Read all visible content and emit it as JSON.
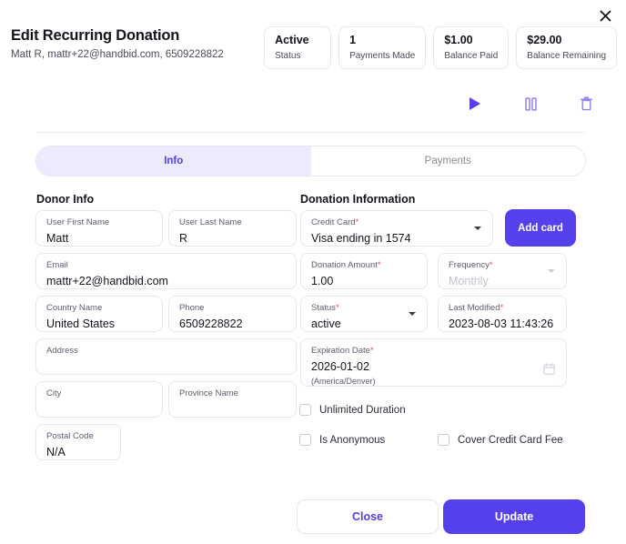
{
  "window": {
    "close_icon": "close-x-icon"
  },
  "header": {
    "title": "Edit Recurring Donation",
    "subtitle": "Matt R, mattr+22@handbid.com, 6509228822",
    "stats": [
      {
        "value": "Active",
        "label": "Status"
      },
      {
        "value": "1",
        "label": "Payments Made"
      },
      {
        "value": "$1.00",
        "label": "Balance Paid"
      },
      {
        "value": "$29.00",
        "label": "Balance Remaining"
      }
    ]
  },
  "actions": [
    {
      "name": "play-icon",
      "tooltip": "Resume"
    },
    {
      "name": "pause-icon",
      "tooltip": "Pause"
    },
    {
      "name": "trash-icon",
      "tooltip": "Delete"
    }
  ],
  "tabs": [
    {
      "label": "Info",
      "active": true
    },
    {
      "label": "Payments",
      "active": false
    }
  ],
  "donor": {
    "section_title": "Donor Info",
    "first_name": {
      "label": "User First Name",
      "value": "Matt"
    },
    "last_name": {
      "label": "User Last Name",
      "value": "R"
    },
    "email": {
      "label": "Email",
      "value": "mattr+22@handbid.com"
    },
    "country": {
      "label": "Country Name",
      "value": "United States"
    },
    "phone": {
      "label": "Phone",
      "value": "6509228822"
    },
    "address": {
      "label": "Address",
      "value": ""
    },
    "city": {
      "label": "City",
      "value": ""
    },
    "province": {
      "label": "Province Name",
      "value": ""
    },
    "postal_code": {
      "label": "Postal Code",
      "value": "N/A"
    }
  },
  "donation": {
    "section_title": "Donation Information",
    "credit_card": {
      "label": "Credit Card",
      "value": "Visa ending in 1574"
    },
    "add_card_label": "Add card",
    "amount": {
      "label": "Donation Amount",
      "value": "1.00"
    },
    "frequency": {
      "label": "Frequency",
      "value": "Monthly"
    },
    "status": {
      "label": "Status",
      "value": "active"
    },
    "last_modified": {
      "label": "Last Modified",
      "value": "2023-08-03 11:43:26"
    },
    "expiration_date": {
      "label": "Expiration Date",
      "value": "2026-01-02",
      "timezone": "(America/Denver)"
    },
    "required_marker": "*"
  },
  "checkboxes": [
    {
      "label": "Unlimited Duration",
      "checked": false
    },
    {
      "label": "Is Anonymous",
      "checked": false
    },
    {
      "label": "Cover Credit Card Fee",
      "checked": false
    }
  ],
  "footer": {
    "close_label": "Close",
    "update_label": "Update"
  },
  "colors": {
    "accent": "#5441ec",
    "accent_soft": "#eceaff",
    "required": "#e8476f",
    "border": "#e6e6ee"
  }
}
